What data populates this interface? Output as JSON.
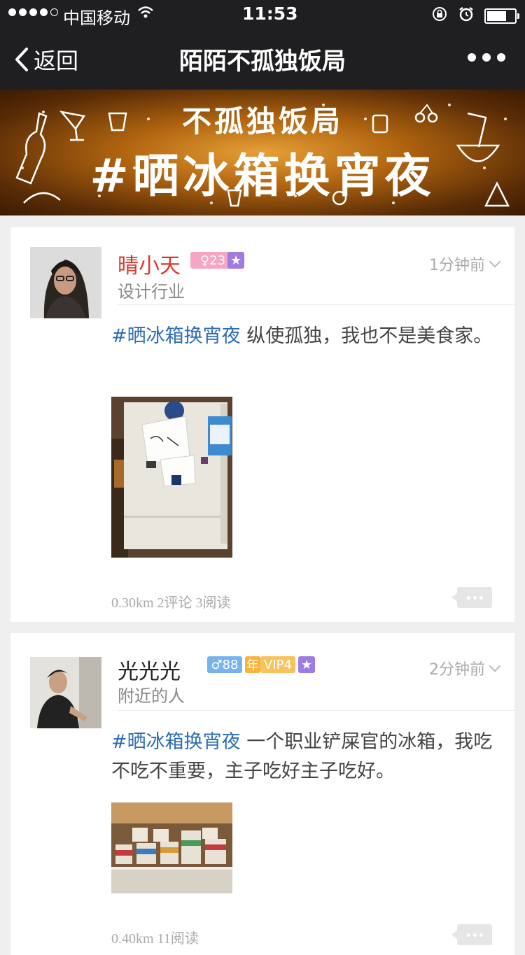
{
  "status_bar": {
    "carrier": "中国移动",
    "time": "11:53"
  },
  "nav": {
    "back_label": "返回",
    "title": "陌陌不孤独饭局"
  },
  "banner": {
    "line1": "不孤独饭局",
    "line2": "#晒冰箱换宵夜"
  },
  "posts": [
    {
      "name": "晴小天",
      "name_color": "#e0342a",
      "level_badge": "23",
      "level_badge_prefix": "♀",
      "subtitle": "设计行业",
      "time": "1分钟前",
      "hashtag": "#晒冰箱换宵夜",
      "text": " 纵使孤独，我也不是美食家。",
      "stats": "0.30km 2评论 3阅读"
    },
    {
      "name": "光光光",
      "name_color": "#222222",
      "level_badge": "88",
      "level_badge_prefix": "♂",
      "year_badge": "年",
      "vip_badge": "VIP4",
      "subtitle": "附近的人",
      "time": "2分钟前",
      "hashtag": "#晒冰箱换宵夜",
      "text": " 一个职业铲屎官的冰箱，我吃不吃不重要，主子吃好主子吃好。",
      "stats": "0.40km 11阅读"
    }
  ],
  "colors": {
    "tag": "#2e6db5",
    "female_badge": "#f37aa4",
    "male_badge": "#79b3ec",
    "star_badge": "#9e7de0",
    "year_badge": "#f7b23c",
    "vip_badge": "#f7b23c"
  }
}
